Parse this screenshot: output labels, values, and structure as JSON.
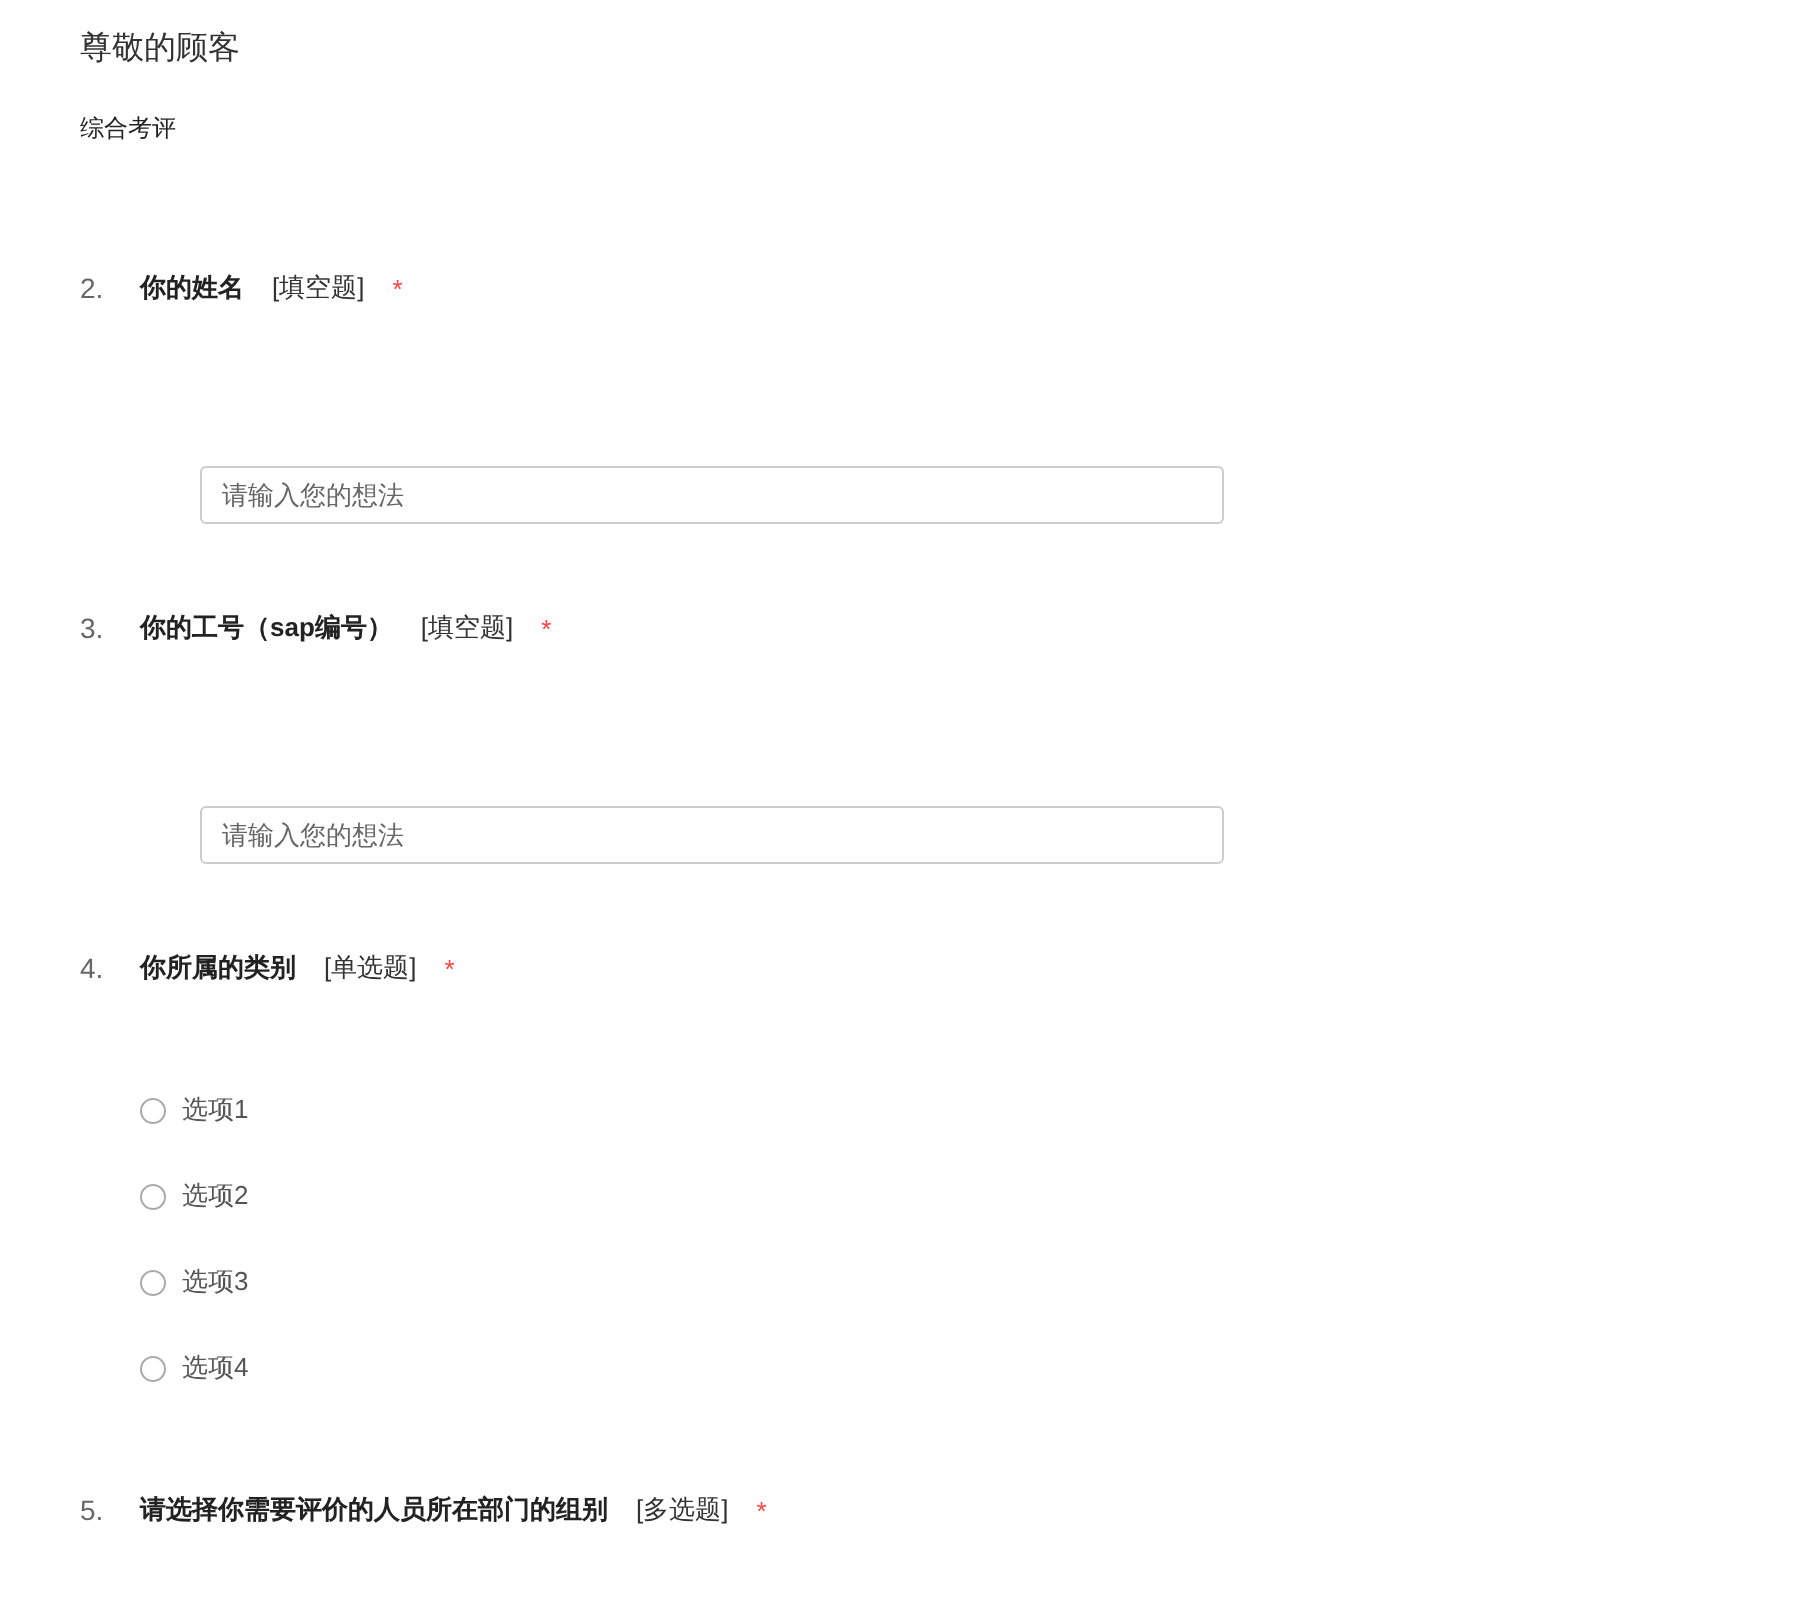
{
  "header": {
    "title": "尊敬的顾客",
    "subtitle": "综合考评"
  },
  "questions": [
    {
      "number": "2.",
      "title": "你的姓名",
      "type": "[填空题]",
      "required_mark": "*",
      "kind": "text",
      "placeholder": "请输入您的想法"
    },
    {
      "number": "3.",
      "title": "你的工号（sap编号）",
      "type": "[填空题]",
      "required_mark": "*",
      "kind": "text",
      "placeholder": "请输入您的想法"
    },
    {
      "number": "4.",
      "title": "你所属的类别",
      "type": "[单选题]",
      "required_mark": "*",
      "kind": "radio",
      "options": [
        {
          "label": "选项1",
          "selected": false
        },
        {
          "label": "选项2",
          "selected": false
        },
        {
          "label": "选项3",
          "selected": false
        },
        {
          "label": "选项4",
          "selected": false
        }
      ]
    },
    {
      "number": "5.",
      "title": "请选择你需要评价的人员所在部门的组别",
      "type": "[多选题]",
      "required_mark": "*",
      "kind": "heading"
    }
  ]
}
